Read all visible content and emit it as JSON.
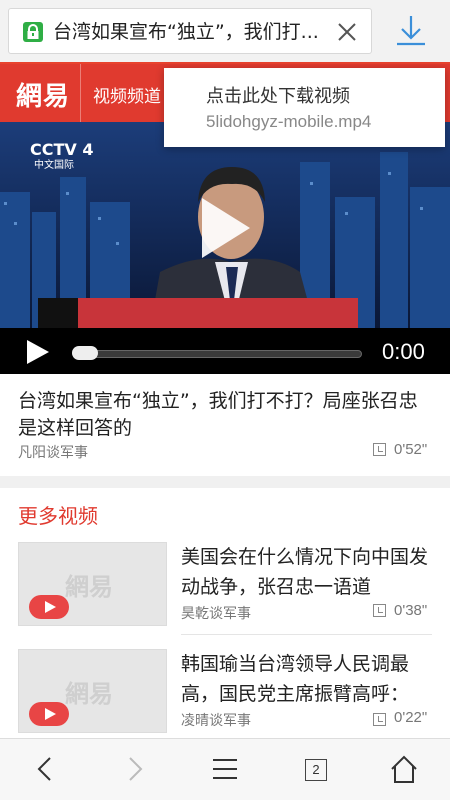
{
  "browser": {
    "url_title": "台湾如果宣布“独立”，我们打...",
    "icons": {
      "lock": "lock-icon",
      "close": "close-icon",
      "download": "download-icon"
    },
    "accent": "#2fae45"
  },
  "site": {
    "logo": "網易",
    "nav_label": "视频频道",
    "brand_color": "#e03a2f"
  },
  "download_popup": {
    "title": "点击此处下载视频",
    "filename": "5lidohgyz-mobile.mp4"
  },
  "video": {
    "channel_logo": "CCTV 4",
    "channel_sub": "中文国际",
    "time": "0:00",
    "progress": 0,
    "title": "台湾如果宣布“独立”，我们打不打？局座张召忠是这样回答的",
    "source": "凡阳谈军事",
    "duration": "0'52\""
  },
  "more_section": {
    "heading": "更多视频",
    "items": [
      {
        "title": "美国会在什么情况下向中国发动战争，张召忠一语道",
        "source": "昊乾谈军事",
        "duration": "0'38\"",
        "watermark": "網易"
      },
      {
        "title": "韩国瑜当台湾领导人民调最高，国民党主席振臂高呼：",
        "source": "凌晴谈军事",
        "duration": "0'22\"",
        "watermark": "網易"
      }
    ]
  },
  "bottom_nav": {
    "tab_count": "2",
    "icons": [
      "back-icon",
      "forward-icon",
      "menu-icon",
      "tabs-icon",
      "home-icon"
    ]
  }
}
